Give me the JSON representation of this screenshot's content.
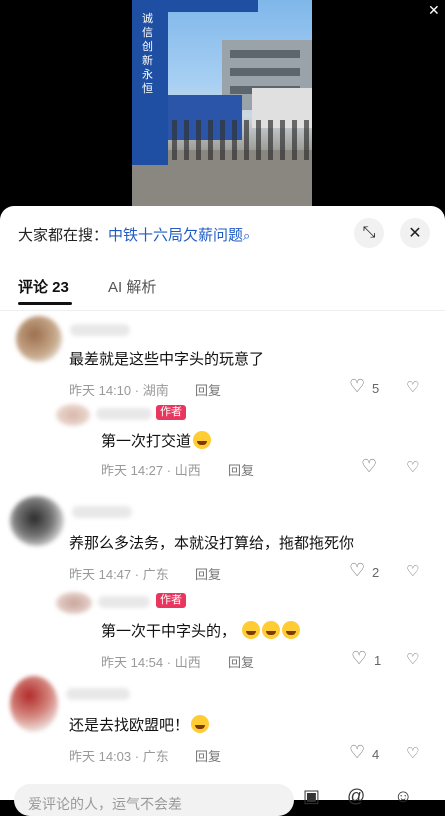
{
  "video": {
    "pillar_text": "诚信创新永恒",
    "close": "✕"
  },
  "search": {
    "prefix": "大家都在搜：",
    "term": "中铁十六局欠薪问题",
    "mag": "⌕"
  },
  "buttons": {
    "expand": "⤡",
    "close": "✕"
  },
  "tabs": [
    {
      "label": "评论 23"
    },
    {
      "label": "AI 解析"
    }
  ],
  "author_tag": "作者",
  "comments": [
    {
      "text": "最差就是这些中字头的玩意了",
      "time": "昨天 14:10 · 湖南",
      "reply": "回复",
      "likes": "5"
    },
    {
      "text": "第一次打交道",
      "time": "昨天 14:27 · 山西",
      "reply": "回复",
      "likes": ""
    },
    {
      "text": "养那么多法务，本就没打算给，拖都拖死你",
      "time": "昨天 14:47 · 广东",
      "reply": "回复",
      "likes": "2"
    },
    {
      "text": "第一次干中字头的，",
      "time": "昨天 14:54 · 山西",
      "reply": "回复",
      "likes": "1"
    },
    {
      "text": "还是去找欧盟吧！",
      "time": "昨天 14:03 · 广东",
      "reply": "回复",
      "likes": "4"
    }
  ],
  "icons": {
    "like": "♡",
    "dislike": "♡",
    "image": "▣",
    "at": "@",
    "emoji": "☺"
  },
  "input": {
    "placeholder": "爱评论的人，运气不会差"
  }
}
